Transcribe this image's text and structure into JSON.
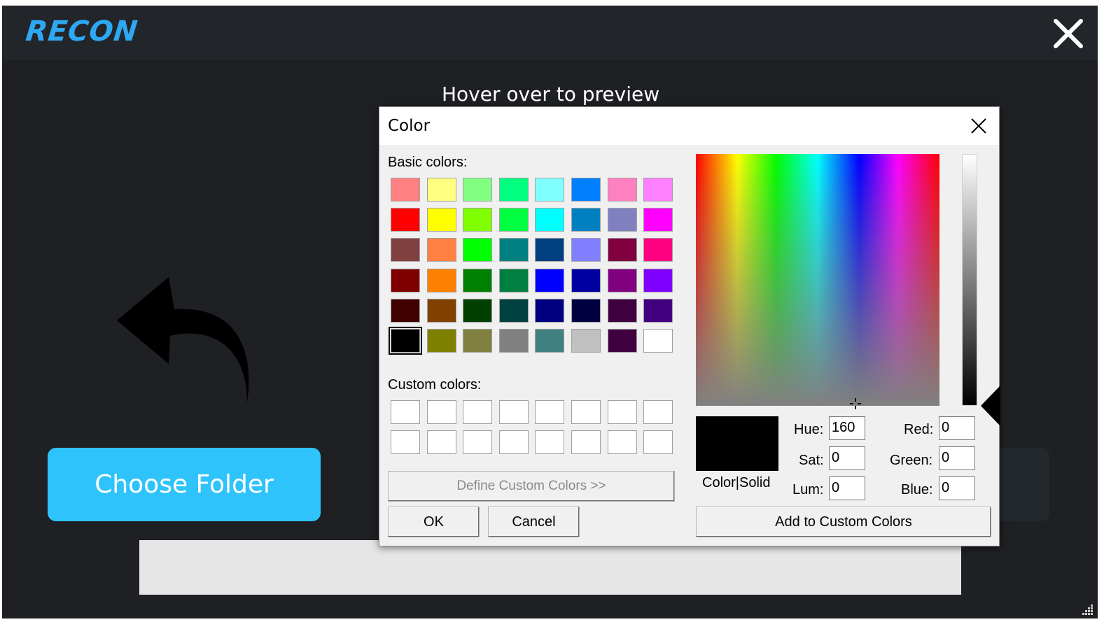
{
  "app": {
    "logo": "RECON",
    "hover_text": "Hover over to preview",
    "choose_folder": "Choose Folder"
  },
  "dialog": {
    "title": "Color",
    "basic_colors_label": "Basic colors:",
    "custom_colors_label": "Custom colors:",
    "basic_colors": [
      "#ff8080",
      "#ffff80",
      "#80ff80",
      "#00ff80",
      "#80ffff",
      "#0080ff",
      "#ff80c0",
      "#ff80ff",
      "#ff0000",
      "#ffff00",
      "#80ff00",
      "#00ff40",
      "#00ffff",
      "#0080c0",
      "#8080c0",
      "#ff00ff",
      "#804040",
      "#ff8040",
      "#00ff00",
      "#008080",
      "#004080",
      "#8080ff",
      "#800040",
      "#ff0080",
      "#800000",
      "#ff8000",
      "#008000",
      "#008040",
      "#0000ff",
      "#0000a0",
      "#800080",
      "#8000ff",
      "#400000",
      "#804000",
      "#004000",
      "#004040",
      "#000080",
      "#000040",
      "#400040",
      "#400080",
      "#000000",
      "#808000",
      "#808040",
      "#808080",
      "#408080",
      "#c0c0c0",
      "#400040",
      "#ffffff"
    ],
    "selected_basic_index": 40,
    "define_custom": "Define Custom Colors >>",
    "ok": "OK",
    "cancel": "Cancel",
    "color_solid": "Color|Solid",
    "hue_label": "Hue:",
    "sat_label": "Sat:",
    "lum_label": "Lum:",
    "red_label": "Red:",
    "green_label": "Green:",
    "blue_label": "Blue:",
    "hue": "160",
    "sat": "0",
    "lum": "0",
    "red": "0",
    "green": "0",
    "blue": "0",
    "add_custom": "Add to Custom Colors"
  }
}
